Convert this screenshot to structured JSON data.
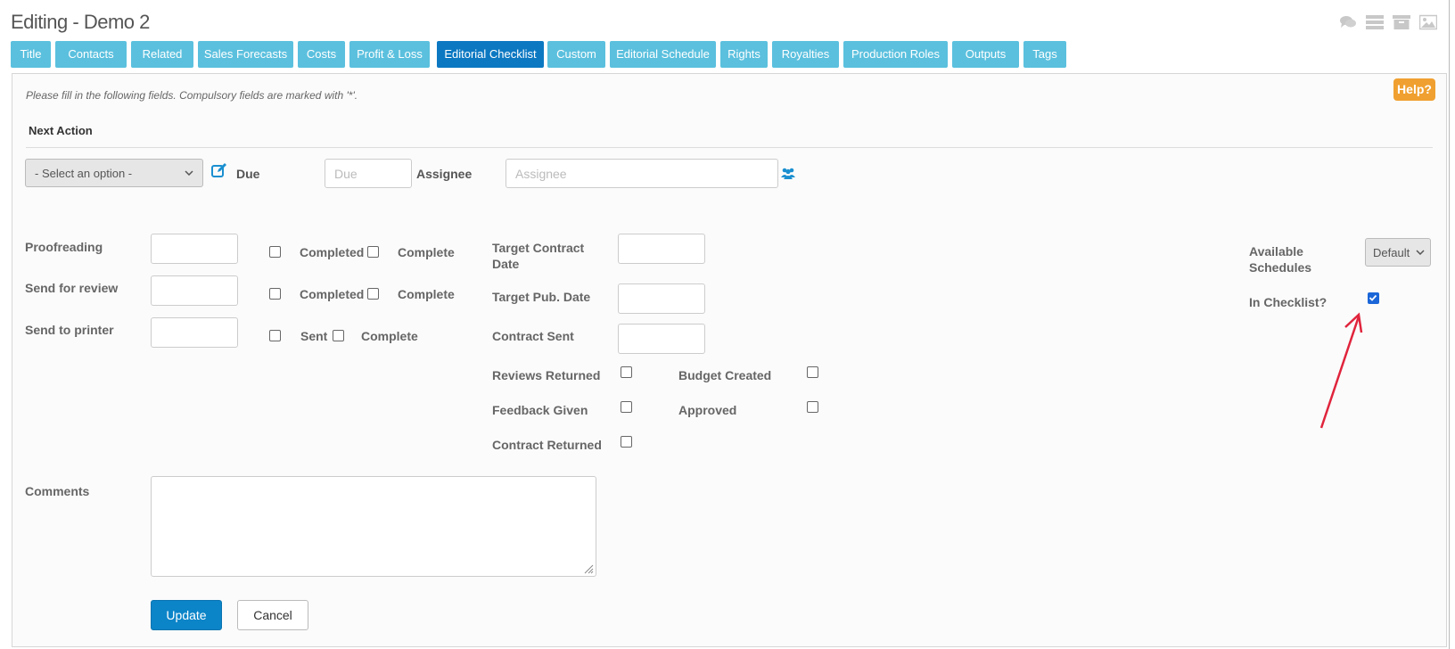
{
  "page": {
    "title": "Editing - Demo 2"
  },
  "top_icons": [
    "comments-icon",
    "list-icon",
    "archive-icon",
    "image-icon"
  ],
  "tabs": [
    {
      "label": "Title",
      "active": false
    },
    {
      "label": "Contacts",
      "active": false
    },
    {
      "label": "Related",
      "active": false
    },
    {
      "label": "Sales Forecasts",
      "active": false
    },
    {
      "label": "Costs",
      "active": false
    },
    {
      "label": "Profit & Loss",
      "active": false
    },
    {
      "label": "Editorial Checklist",
      "active": true
    },
    {
      "label": "Custom",
      "active": false
    },
    {
      "label": "Editorial Schedule",
      "active": false
    },
    {
      "label": "Rights",
      "active": false
    },
    {
      "label": "Royalties",
      "active": false
    },
    {
      "label": "Production Roles",
      "active": false
    },
    {
      "label": "Outputs",
      "active": false
    },
    {
      "label": "Tags",
      "active": false
    }
  ],
  "help": {
    "label": "Help?"
  },
  "form": {
    "intro": "Please fill in the following fields. Compulsory fields are marked with '*'.",
    "next_action": {
      "heading": "Next Action",
      "select_value": "- Select an option -",
      "due_label": "Due",
      "due_placeholder": "Due",
      "assignee_label": "Assignee",
      "assignee_placeholder": "Assignee"
    },
    "tasks": [
      {
        "label": "Proofreading",
        "check1": "Completed",
        "check2": "Complete"
      },
      {
        "label": "Send for review",
        "check1": "Completed",
        "check2": "Complete"
      },
      {
        "label": "Send to printer",
        "check1": "Sent",
        "check2": "Complete"
      }
    ],
    "dates": {
      "target_contract_line1": "Target Contract",
      "target_contract_line2": "Date",
      "target_pub": "Target Pub. Date",
      "contract_sent": "Contract Sent"
    },
    "checkboxes": {
      "reviews_returned": "Reviews Returned",
      "budget_created": "Budget Created",
      "feedback_given": "Feedback Given",
      "approved": "Approved",
      "contract_returned": "Contract Returned"
    },
    "schedules": {
      "label_line1": "Available",
      "label_line2": "Schedules",
      "value": "Default",
      "in_checklist_label": "In Checklist?",
      "in_checklist_checked": true
    },
    "comments_label": "Comments",
    "update_label": "Update",
    "cancel_label": "Cancel"
  },
  "colors": {
    "tab": "#5bc0de",
    "tab_active": "#0c78c2",
    "help": "#f0a030",
    "primary": "#0c84c8",
    "arrow": "#e0243c"
  }
}
